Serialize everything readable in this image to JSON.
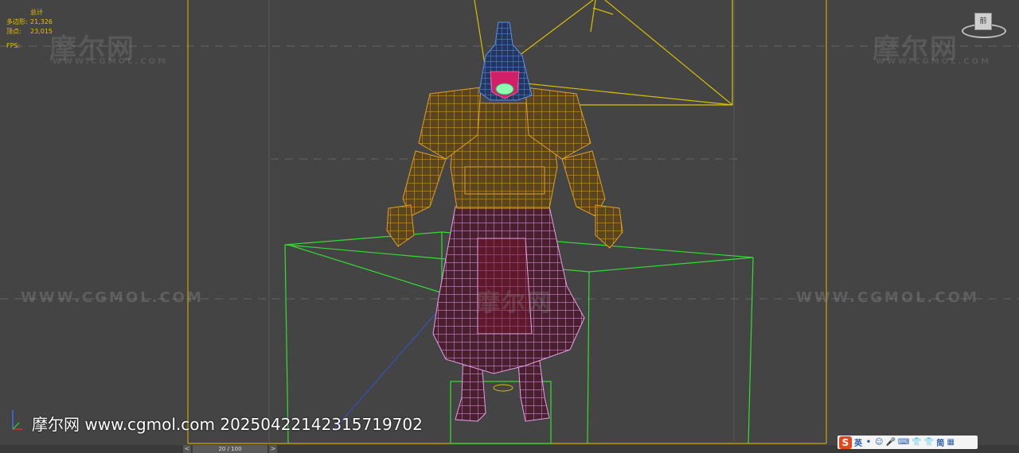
{
  "stats": {
    "header": "总计",
    "polygons_label": "多边形:",
    "polygons_value": "21,326",
    "vertices_label": "顶点:",
    "vertices_value": "23,015",
    "fps_label": "FPS:"
  },
  "watermarks": {
    "logo": "摩尔网",
    "sub": "WWW.CGMOL.COM",
    "url": "WWW.CGMOL.COM"
  },
  "overlay": {
    "caption": "摩尔网 www.cgmol.com 20250422142315719702"
  },
  "viewcube": {
    "face_label": "前"
  },
  "timeline": {
    "prev": "<",
    "next": ">",
    "frame": "20 / 100"
  },
  "ime": {
    "logo": "S",
    "items": [
      "英",
      "•",
      "☺",
      "🎤",
      "⌨",
      "👕",
      "👕",
      "简",
      "▦"
    ]
  },
  "colors": {
    "background": "#444444",
    "armor": "#e0a020",
    "helmet": "#4a7fd8",
    "skirt": "#e6a0e6",
    "face": "#d21f68",
    "bbox": "#33dd33",
    "camera": "#d8c000",
    "grid": "#6a6a6a"
  }
}
